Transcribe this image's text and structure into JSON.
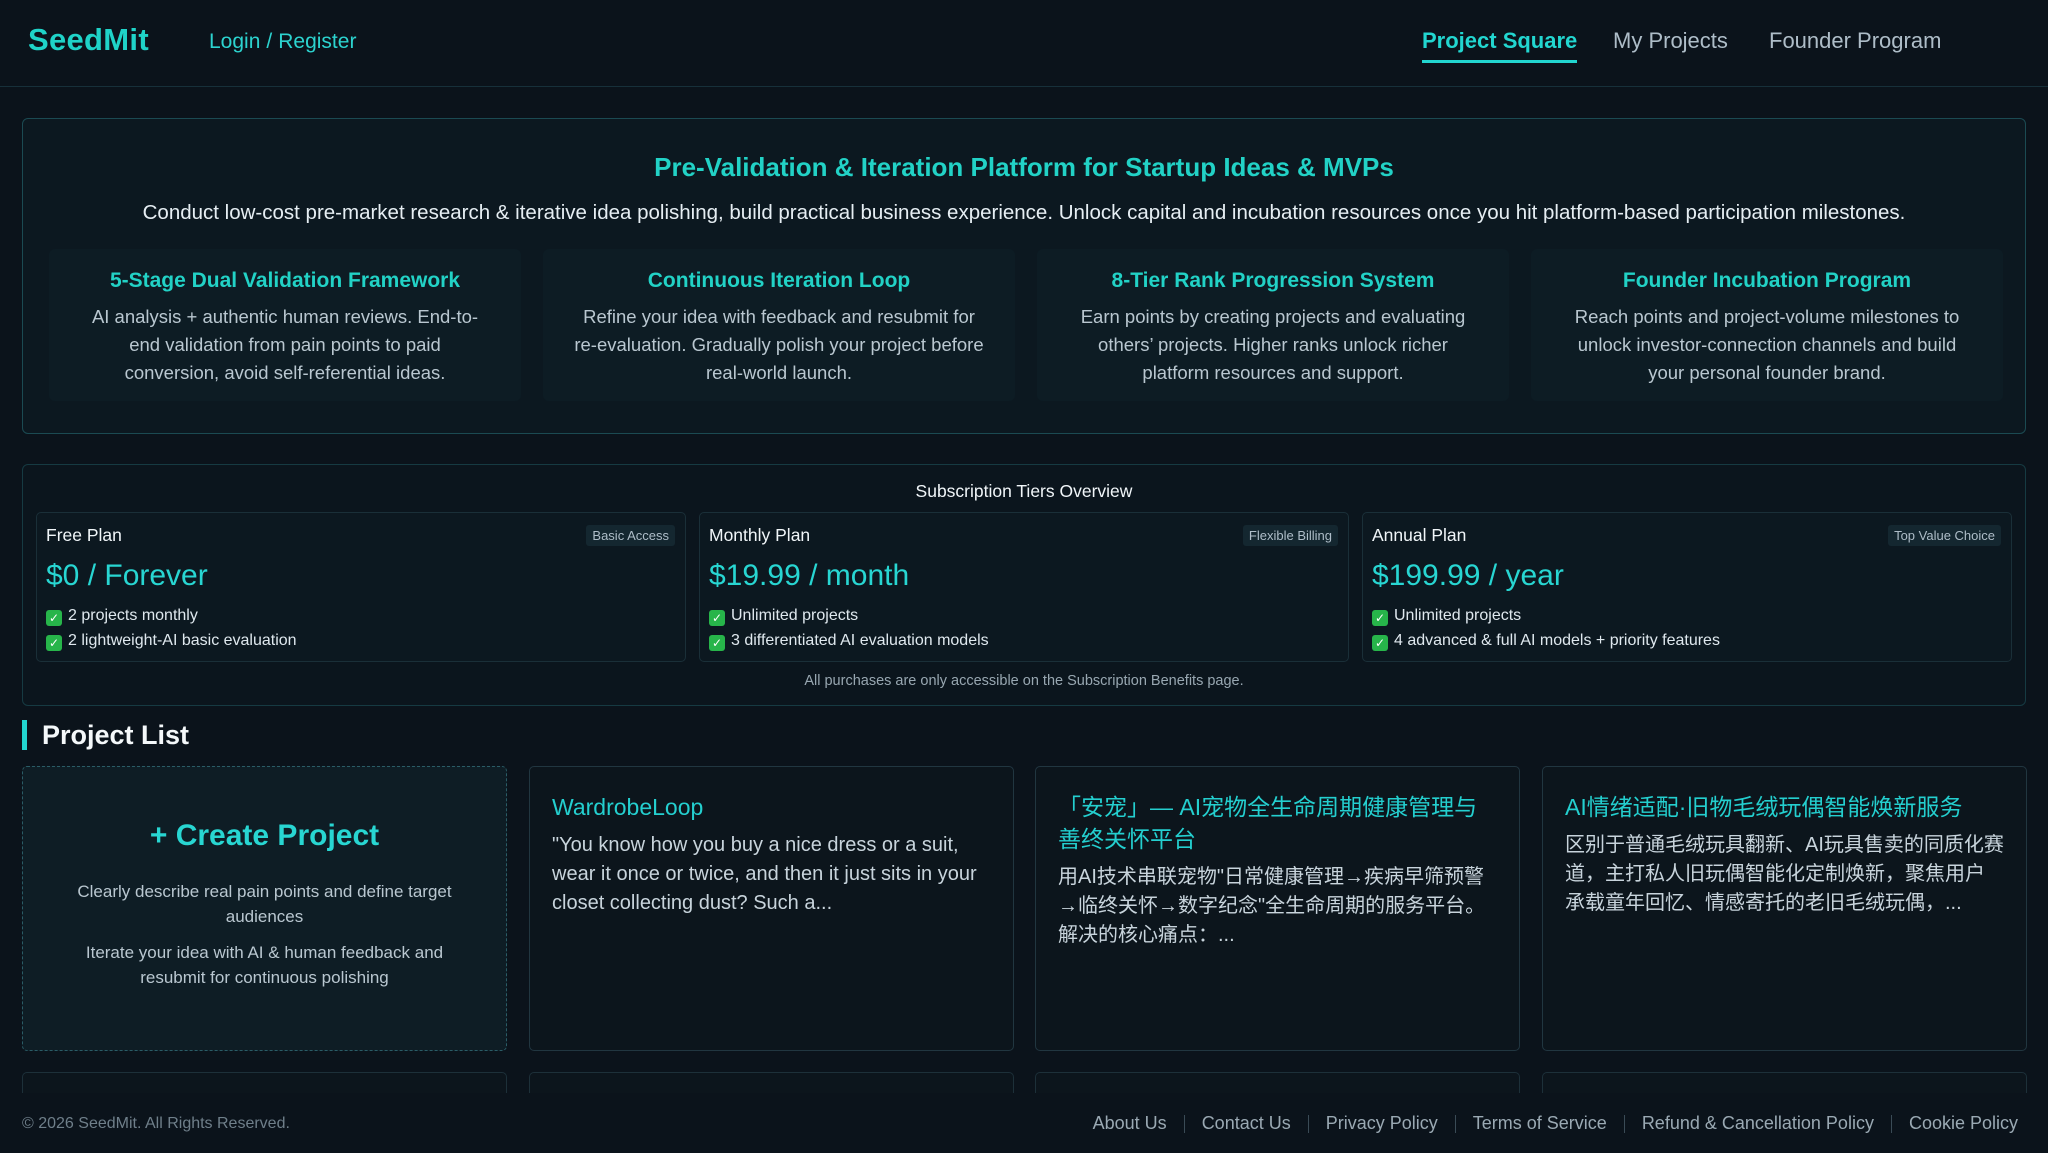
{
  "header": {
    "logo": "SeedMit",
    "login": "Login",
    "register": "Register",
    "login_sep": "/",
    "nav": [
      {
        "label": "Project Square",
        "active": true
      },
      {
        "label": "My Projects",
        "active": false
      },
      {
        "label": "Founder Program",
        "active": false
      }
    ]
  },
  "hero": {
    "title": "Pre-Validation & Iteration Platform for Startup Ideas & MVPs",
    "subtitle": "Conduct low-cost pre-market research & iterative idea polishing, build practical business experience. Unlock capital and incubation resources once you hit platform-based participation milestones.",
    "features": [
      {
        "title": "5-Stage Dual Validation Framework",
        "lines": [
          "AI analysis + authentic human reviews. End-to-",
          "end validation from pain points to paid",
          "conversion, avoid self-referential ideas."
        ]
      },
      {
        "title": "Continuous Iteration Loop",
        "lines": [
          "Refine your idea with feedback and resubmit for",
          "re-evaluation. Gradually polish your project before",
          "real-world launch."
        ]
      },
      {
        "title": "8-Tier Rank Progression System",
        "lines": [
          "Earn points by creating projects and evaluating",
          "others’ projects. Higher ranks unlock richer",
          "platform resources and support."
        ]
      },
      {
        "title": "Founder Incubation Program",
        "lines": [
          "Reach points and project-volume milestones to",
          "unlock investor-connection channels and build",
          "your personal founder brand."
        ]
      }
    ]
  },
  "subscriptions": {
    "title": "Subscription Tiers Overview",
    "plans": [
      {
        "name": "Free Plan",
        "badge": "Basic Access",
        "price": "$0 / Forever",
        "features": [
          "2 projects monthly",
          "2 lightweight-AI basic evaluation"
        ]
      },
      {
        "name": "Monthly Plan",
        "badge": "Flexible Billing",
        "price": "$19.99 / month",
        "features": [
          "Unlimited projects",
          "3 differentiated AI evaluation models"
        ]
      },
      {
        "name": "Annual Plan",
        "badge": "Top Value Choice",
        "price": "$199.99 / year",
        "features": [
          "Unlimited projects",
          "4 advanced & full AI models + priority features"
        ]
      }
    ],
    "note": "All purchases are only accessible on the Subscription Benefits page."
  },
  "projects": {
    "section_title": "Project List",
    "create": {
      "title": "+ Create Project",
      "line1": "Clearly describe real pain points and define target audiences",
      "line2": "Iterate your idea with AI & human feedback and resubmit for continuous polishing"
    },
    "cards": [
      {
        "title": "WardrobeLoop",
        "desc": "\"You know how you buy a nice dress or a suit, wear it once or twice, and then it just sits in your closet collecting dust? Such a..."
      },
      {
        "title": "「安宠」— AI宠物全生命周期健康管理与善终关怀平台",
        "desc": "用AI技术串联宠物\"日常健康管理→疾病早筛预警→临终关怀→数字纪念\"全生命周期的服务平台。解决的核心痛点：..."
      },
      {
        "title": "AI情绪适配·旧物毛绒玩偶智能焕新服务",
        "desc": "区别于普通毛绒玩具翻新、AI玩具售卖的同质化赛道，主打私人旧玩偶智能化定制焕新，聚焦用户承载童年回忆、情感寄托的老旧毛绒玩偶，..."
      }
    ]
  },
  "footer": {
    "copyright": "© 2026 SeedMit. All Rights Reserved.",
    "links": [
      "About Us",
      "Contact Us",
      "Privacy Policy",
      "Terms of Service",
      "Refund & Cancellation Policy",
      "Cookie Policy"
    ]
  },
  "colors": {
    "accent": "#22d6d0",
    "background": "#0b131b",
    "check": "#27b54a"
  }
}
